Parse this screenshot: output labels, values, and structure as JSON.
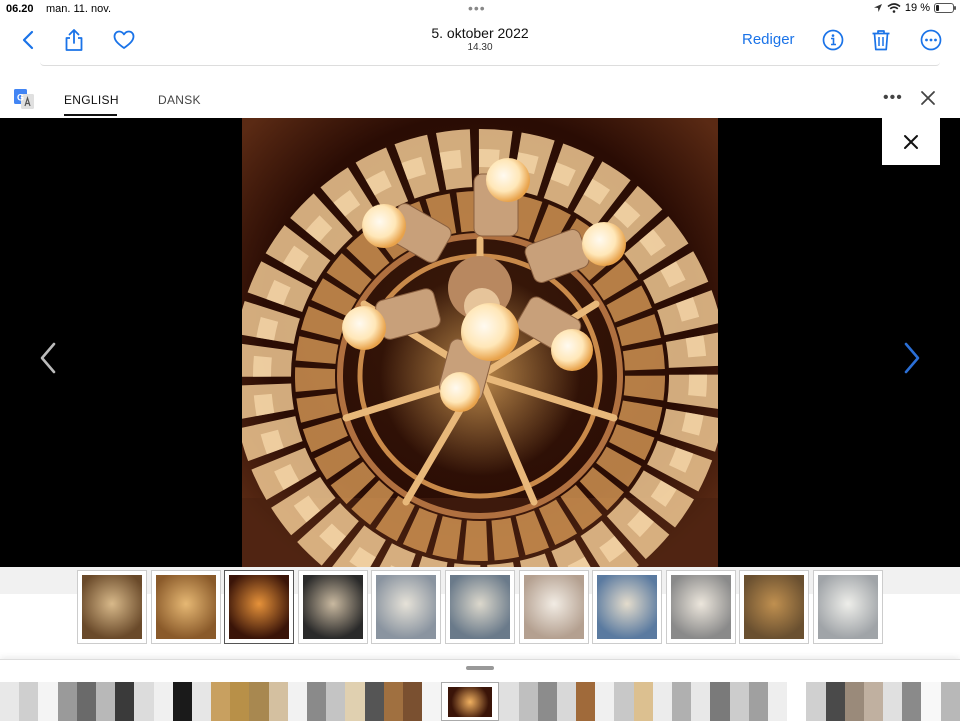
{
  "status_bar": {
    "time": "06.20",
    "date": "man. 11. nov.",
    "battery": "19 %",
    "battery_level": 0.19
  },
  "nav": {
    "title": "5. oktober 2022",
    "subtitle": "14.30",
    "edit_label": "Rediger",
    "accent": "#1a73e8"
  },
  "translate_bar": {
    "languages": [
      {
        "label": "ENGLISH",
        "active": true
      },
      {
        "label": "DANSK",
        "active": false
      }
    ],
    "icons": [
      "google-translate-icon",
      "more-icon",
      "close-icon"
    ]
  },
  "thumbnails": {
    "selected_index": 2,
    "items": [
      {
        "tone": [
          "#6a4a2a",
          "#d8b98a"
        ]
      },
      {
        "tone": [
          "#8a5a2a",
          "#e6b874"
        ]
      },
      {
        "tone": [
          "#3a1408",
          "#e6923a"
        ]
      },
      {
        "tone": [
          "#2a2a2a",
          "#c9b9a0"
        ]
      },
      {
        "tone": [
          "#8a94a0",
          "#e6e2d8"
        ]
      },
      {
        "tone": [
          "#6a7a8a",
          "#dcd8cc"
        ]
      },
      {
        "tone": [
          "#b4a090",
          "#f2ece4"
        ]
      },
      {
        "tone": [
          "#5a7aa0",
          "#e4dccc"
        ]
      },
      {
        "tone": [
          "#8a8a8a",
          "#ece6dc"
        ]
      },
      {
        "tone": [
          "#6a5030",
          "#c09050"
        ]
      },
      {
        "tone": [
          "#a0a4a8",
          "#eeeeea"
        ]
      }
    ]
  },
  "mini_strip": {
    "colors": [
      "#e8e8e8",
      "#cfcfcf",
      "#f4f4f4",
      "#9a9a9a",
      "#6a6a6a",
      "#b8b8b8",
      "#3a3a3a",
      "#dcdcdc",
      "#f0f0f0",
      "#1a1a1a",
      "#e6e6e6",
      "#c8a060",
      "#b89048",
      "#a88850",
      "#d4c0a0",
      "#f2f2f2",
      "#8a8a8a",
      "#c4c4c4",
      "#e0d0b0",
      "#555555",
      "#a07040",
      "#7a5030",
      "#f4f4f4",
      "#ffffff",
      "#e0e0e0",
      "#bfbfbf",
      "#8c8c8c",
      "#d8d8d8",
      "#a06a3a",
      "#f0f0f0",
      "#c8c8c8",
      "#dcc090",
      "#ececec",
      "#b0b0b0",
      "#e8e8e8",
      "#7a7a7a",
      "#cccccc",
      "#a0a0a0",
      "#eeeeee",
      "#ffffff",
      "#d0d0d0",
      "#4a4a4a",
      "#9a8a7a",
      "#c0b0a0",
      "#e0e0e0",
      "#8a8a8a",
      "#f8f8f8",
      "#b8b8b8"
    ],
    "current_index": 23
  }
}
